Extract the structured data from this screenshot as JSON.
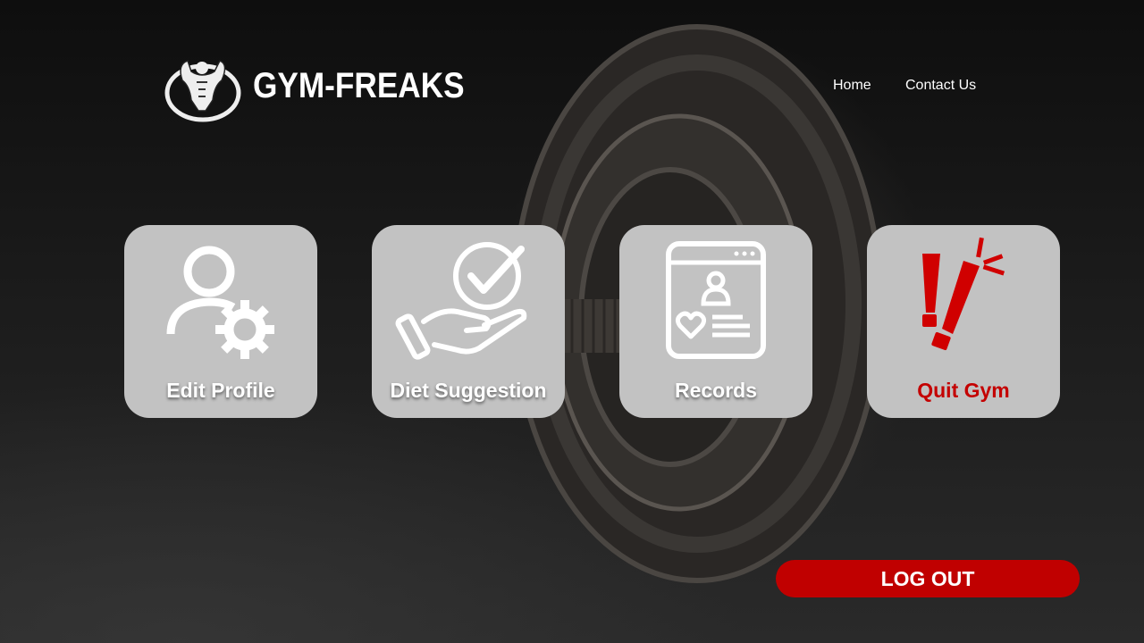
{
  "brand": {
    "name": "GYM-FREAKS",
    "logo_icon": "bodybuilder-logo-icon"
  },
  "nav": {
    "home": "Home",
    "contact": "Contact Us"
  },
  "cards": [
    {
      "label": "Edit Profile",
      "icon": "user-settings-icon"
    },
    {
      "label": "Diet Suggestion",
      "icon": "hand-checkmark-icon"
    },
    {
      "label": "Records",
      "icon": "profile-record-icon"
    },
    {
      "label": "Quit Gym",
      "icon": "exclamation-icon"
    }
  ],
  "logout": {
    "label": "LOG OUT"
  },
  "colors": {
    "accent": "#c00000",
    "card_bg": "#c2c2c2",
    "text": "#ffffff"
  }
}
